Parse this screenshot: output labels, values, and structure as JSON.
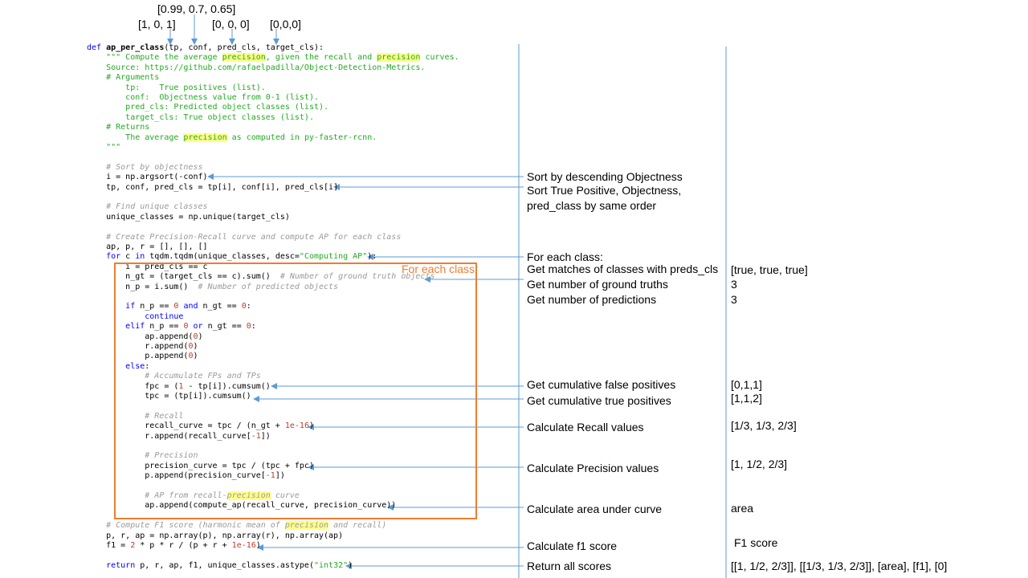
{
  "input_values": {
    "conf": "[0.99, 0.7, 0.65]",
    "tp": "[1, 0, 1]",
    "pred_cls": "[0, 0, 0]",
    "target_cls": "[0,0,0]"
  },
  "loop_box_label": "For each class",
  "colors": {
    "arrow": "#5b9bd5",
    "box": "#ed7d31",
    "keyword": "#0000ff",
    "string": "#22aa22",
    "comment": "#9a9a9a",
    "number": "#c0392b",
    "highlight": "#ffff88"
  },
  "code": [
    {
      "indent": 0,
      "tokens": [
        [
          "def",
          "kw"
        ],
        [
          " ",
          ""
        ],
        [
          "ap_per_class",
          "fn"
        ],
        [
          "(tp, conf, pred_cls, target_cls):",
          ""
        ]
      ]
    },
    {
      "indent": 4,
      "tokens": [
        [
          "\"\"\" Compute the average ",
          "doc"
        ],
        [
          "precision",
          "doc hl"
        ],
        [
          ", given the recall and ",
          "doc"
        ],
        [
          "precision",
          "doc hl"
        ],
        [
          " curves.",
          "doc"
        ]
      ]
    },
    {
      "indent": 4,
      "tokens": [
        [
          "Source: https://github.com/rafaelpadilla/Object-Detection-Metrics.",
          "doc"
        ]
      ]
    },
    {
      "indent": 4,
      "tokens": [
        [
          "# Arguments",
          "doc"
        ]
      ]
    },
    {
      "indent": 8,
      "tokens": [
        [
          "tp:    True positives (list).",
          "doc"
        ]
      ]
    },
    {
      "indent": 8,
      "tokens": [
        [
          "conf:  Objectness value from 0-1 (list).",
          "doc"
        ]
      ]
    },
    {
      "indent": 8,
      "tokens": [
        [
          "pred_cls: Predicted object classes (list).",
          "doc"
        ]
      ]
    },
    {
      "indent": 8,
      "tokens": [
        [
          "target_cls: True object classes (list).",
          "doc"
        ]
      ]
    },
    {
      "indent": 4,
      "tokens": [
        [
          "# Returns",
          "doc"
        ]
      ]
    },
    {
      "indent": 8,
      "tokens": [
        [
          "The average ",
          "doc"
        ],
        [
          "precision",
          "doc hl"
        ],
        [
          " as computed in py-faster-rcnn.",
          "doc"
        ]
      ]
    },
    {
      "indent": 4,
      "tokens": [
        [
          "\"\"\"",
          "doc"
        ]
      ]
    },
    {
      "indent": 0,
      "tokens": []
    },
    {
      "indent": 4,
      "tokens": [
        [
          "# Sort by objectness",
          "cm"
        ]
      ]
    },
    {
      "indent": 4,
      "tokens": [
        [
          "i = np.argsort(-conf)",
          ""
        ]
      ]
    },
    {
      "indent": 4,
      "tokens": [
        [
          "tp, conf, pred_cls = tp[i], conf[i], pred_cls[i]",
          ""
        ]
      ]
    },
    {
      "indent": 0,
      "tokens": []
    },
    {
      "indent": 4,
      "tokens": [
        [
          "# Find unique classes",
          "cm"
        ]
      ]
    },
    {
      "indent": 4,
      "tokens": [
        [
          "unique_classes = np.unique(target_cls)",
          ""
        ]
      ]
    },
    {
      "indent": 0,
      "tokens": []
    },
    {
      "indent": 4,
      "tokens": [
        [
          "# Create Precision-Recall curve and compute AP for each class",
          "cm"
        ]
      ]
    },
    {
      "indent": 4,
      "tokens": [
        [
          "ap, p, r = [], [], []",
          ""
        ]
      ]
    },
    {
      "indent": 4,
      "tokens": [
        [
          "for",
          "kw"
        ],
        [
          " c ",
          ""
        ],
        [
          "in",
          "kw"
        ],
        [
          " tqdm.tqdm(unique_classes, desc=",
          ""
        ],
        [
          "\"Computing AP\"",
          "str"
        ],
        [
          "):",
          ""
        ]
      ]
    },
    {
      "indent": 8,
      "tokens": [
        [
          "i = pred_cls == c",
          ""
        ]
      ]
    },
    {
      "indent": 8,
      "tokens": [
        [
          "n_gt = (target_cls == c).sum()  ",
          ""
        ],
        [
          "# Number of ground truth objects",
          "cm"
        ]
      ]
    },
    {
      "indent": 8,
      "tokens": [
        [
          "n_p = i.sum()  ",
          ""
        ],
        [
          "# Number of predicted objects",
          "cm"
        ]
      ]
    },
    {
      "indent": 0,
      "tokens": []
    },
    {
      "indent": 8,
      "tokens": [
        [
          "if",
          "kw"
        ],
        [
          " n_p == ",
          ""
        ],
        [
          "0",
          "num"
        ],
        [
          " ",
          ""
        ],
        [
          "and",
          "kw"
        ],
        [
          " n_gt == ",
          ""
        ],
        [
          "0",
          "num"
        ],
        [
          ":",
          ""
        ]
      ]
    },
    {
      "indent": 12,
      "tokens": [
        [
          "continue",
          "kw"
        ]
      ]
    },
    {
      "indent": 8,
      "tokens": [
        [
          "elif",
          "kw"
        ],
        [
          " n_p == ",
          ""
        ],
        [
          "0",
          "num"
        ],
        [
          " ",
          ""
        ],
        [
          "or",
          "kw"
        ],
        [
          " n_gt == ",
          ""
        ],
        [
          "0",
          "num"
        ],
        [
          ":",
          ""
        ]
      ]
    },
    {
      "indent": 12,
      "tokens": [
        [
          "ap.append(",
          ""
        ],
        [
          "0",
          "num"
        ],
        [
          ")",
          ""
        ]
      ]
    },
    {
      "indent": 12,
      "tokens": [
        [
          "r.append(",
          ""
        ],
        [
          "0",
          "num"
        ],
        [
          ")",
          ""
        ]
      ]
    },
    {
      "indent": 12,
      "tokens": [
        [
          "p.append(",
          ""
        ],
        [
          "0",
          "num"
        ],
        [
          ")",
          ""
        ]
      ]
    },
    {
      "indent": 8,
      "tokens": [
        [
          "else",
          "kw"
        ],
        [
          ":",
          ""
        ]
      ]
    },
    {
      "indent": 12,
      "tokens": [
        [
          "# Accumulate FPs and TPs",
          "cm"
        ]
      ]
    },
    {
      "indent": 12,
      "tokens": [
        [
          "fpc = (",
          ""
        ],
        [
          "1",
          "num"
        ],
        [
          " - tp[i]).cumsum()",
          ""
        ]
      ]
    },
    {
      "indent": 12,
      "tokens": [
        [
          "tpc = (tp[i]).cumsum()",
          ""
        ]
      ]
    },
    {
      "indent": 0,
      "tokens": []
    },
    {
      "indent": 12,
      "tokens": [
        [
          "# Recall",
          "cm"
        ]
      ]
    },
    {
      "indent": 12,
      "tokens": [
        [
          "recall_curve = tpc / (n_gt + ",
          ""
        ],
        [
          "1e-16",
          "num"
        ],
        [
          ")",
          ""
        ]
      ]
    },
    {
      "indent": 12,
      "tokens": [
        [
          "r.append(recall_curve[",
          ""
        ],
        [
          "-1",
          "num"
        ],
        [
          "])",
          ""
        ]
      ]
    },
    {
      "indent": 0,
      "tokens": []
    },
    {
      "indent": 12,
      "tokens": [
        [
          "# Precision",
          "cm"
        ]
      ]
    },
    {
      "indent": 12,
      "tokens": [
        [
          "precision_curve = tpc / (tpc + fpc)",
          ""
        ]
      ]
    },
    {
      "indent": 12,
      "tokens": [
        [
          "p.append(precision_curve[",
          ""
        ],
        [
          "-1",
          "num"
        ],
        [
          "])",
          ""
        ]
      ]
    },
    {
      "indent": 0,
      "tokens": []
    },
    {
      "indent": 12,
      "tokens": [
        [
          "# AP from recall-",
          "cm"
        ],
        [
          "precision",
          "cm hl"
        ],
        [
          " curve",
          "cm"
        ]
      ]
    },
    {
      "indent": 12,
      "tokens": [
        [
          "ap.append(compute_ap(recall_curve, precision_curve))",
          ""
        ]
      ]
    },
    {
      "indent": 0,
      "tokens": []
    },
    {
      "indent": 4,
      "tokens": [
        [
          "# Compute F1 score (harmonic mean of ",
          "cm"
        ],
        [
          "precision",
          "cm hl"
        ],
        [
          " and recall)",
          "cm"
        ]
      ]
    },
    {
      "indent": 4,
      "tokens": [
        [
          "p, r, ap = np.array(p), np.array(r), np.array(ap)",
          ""
        ]
      ]
    },
    {
      "indent": 4,
      "tokens": [
        [
          "f1 = ",
          ""
        ],
        [
          "2",
          "num"
        ],
        [
          " * p * r / (p + r + ",
          ""
        ],
        [
          "1e-16",
          "num"
        ],
        [
          ")",
          ""
        ]
      ]
    },
    {
      "indent": 0,
      "tokens": []
    },
    {
      "indent": 4,
      "tokens": [
        [
          "return",
          "kw"
        ],
        [
          " p, r, ap, f1, unique_classes.astype(",
          ""
        ],
        [
          "\"int32\"",
          "str"
        ],
        [
          ")",
          ""
        ]
      ]
    }
  ],
  "annotations": [
    {
      "label": "Sort by descending Objectness",
      "value": ""
    },
    {
      "label": "Sort True Positive, Objectness,",
      "value": ""
    },
    {
      "label": "pred_class by same order",
      "value": ""
    },
    {
      "label": "For each class:",
      "value": ""
    },
    {
      "label": "Get matches of classes with preds_cls",
      "value": "[true, true, true]"
    },
    {
      "label": "Get number of ground truths",
      "value": "3"
    },
    {
      "label": "Get number of predictions",
      "value": "3"
    },
    {
      "label": "Get cumulative false positives",
      "value": "[0,1,1]"
    },
    {
      "label": "Get cumulative true positives",
      "value": "[1,1,2]"
    },
    {
      "label": "Calculate Recall values",
      "value": "[1/3, 1/3, 2/3]"
    },
    {
      "label": "Calculate Precision values",
      "value": "[1, 1/2, 2/3]"
    },
    {
      "label": "Calculate area under curve",
      "value": "area"
    },
    {
      "label": "Calculate f1 score",
      "value": "F1 score"
    },
    {
      "label": "Return all scores",
      "value": "[[1, 1/2, 2/3]], [[1/3, 1/3, 2/3]], [area], [f1], [0]"
    }
  ]
}
